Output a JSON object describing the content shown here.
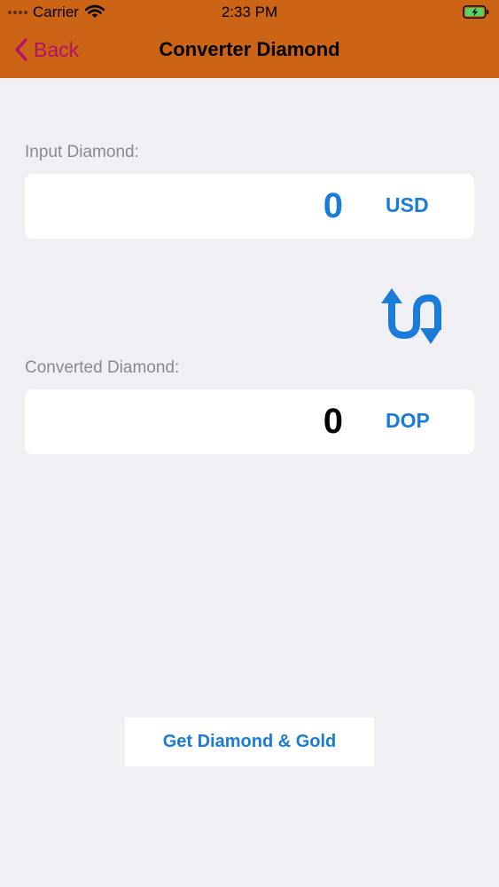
{
  "status_bar": {
    "carrier": "Carrier",
    "time": "2:33 PM",
    "icons": [
      "signal-icon",
      "wifi-icon",
      "battery-icon"
    ]
  },
  "nav": {
    "back_label": "Back",
    "title": "Converter Diamond",
    "background_color": "#cc6415",
    "back_color": "#b3126b"
  },
  "input": {
    "label": "Input Diamond:",
    "value": "0",
    "currency": "USD",
    "value_color": "#1a7bd8"
  },
  "swap": {
    "icon": "swap-arrows-icon"
  },
  "output": {
    "label": "Converted Diamond:",
    "value": "0",
    "currency": "DOP",
    "value_color": "#000000"
  },
  "actions": {
    "get_label": "Get Diamond & Gold"
  },
  "colors": {
    "accent": "#1a7bd8",
    "background": "#f0eff4"
  }
}
